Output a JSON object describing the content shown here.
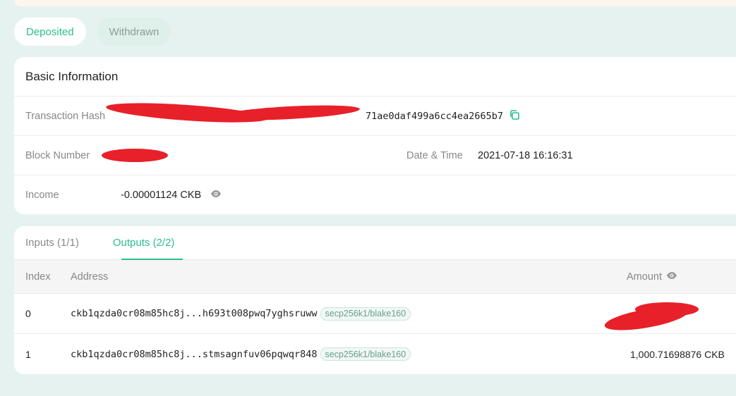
{
  "toggle": {
    "deposited_label": "Deposited",
    "withdrawn_label": "Withdrawn"
  },
  "basic_info": {
    "title": "Basic Information",
    "tx_hash_label": "Transaction Hash",
    "tx_hash_visible": "71ae0daf499a6cc4ea2665b7",
    "block_number_label": "Block Number",
    "date_time_label": "Date & Time",
    "date_time_value": "2021-07-18 16:16:31",
    "income_label": "Income",
    "income_value": "-0.00001124 CKB"
  },
  "io": {
    "tabs": [
      {
        "label": "Inputs (1/1)",
        "active": false
      },
      {
        "label": "Outputs (2/2)",
        "active": true
      }
    ],
    "columns": {
      "index": "Index",
      "address": "Address",
      "amount": "Amount"
    },
    "rows": [
      {
        "index": "0",
        "address": "ckb1qzda0cr08m85hc8j...h693t008pwq7yghsruww",
        "lock": "secp256k1/blake160",
        "amount": ""
      },
      {
        "index": "1",
        "address": "ckb1qzda0cr08m85hc8j...stmsagnfuv06pqwqr848",
        "lock": "secp256k1/blake160",
        "amount": "1,000.71698876 CKB"
      }
    ]
  },
  "colors": {
    "accent": "#2bbd8f",
    "page_background": "#e6f2ef",
    "redaction": "#e8202a"
  }
}
